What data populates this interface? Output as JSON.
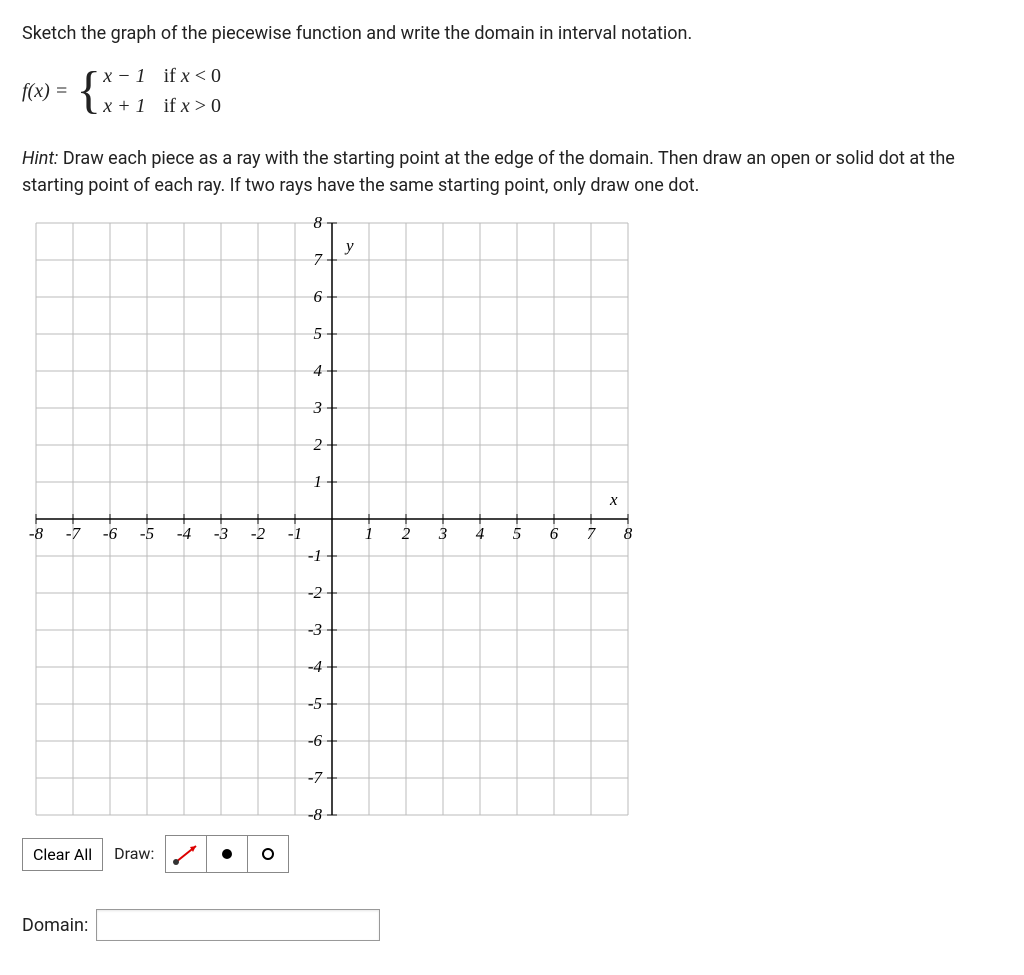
{
  "problem": {
    "instruction": "Sketch the graph of the piecewise function and write the domain in interval notation.",
    "func_lhs": "f(x) = ",
    "piece1_expr": "x − 1",
    "piece1_cond_prefix": "if ",
    "piece1_cond_rel": " < 0",
    "piece2_expr": "x + 1",
    "piece2_cond_prefix": "if ",
    "piece2_cond_rel": " > 0",
    "var": "x"
  },
  "hint": {
    "label": "Hint:",
    "text": " Draw each piece as a ray with the starting point at the edge of the domain. Then draw an open or solid dot at the starting point of each ray. If two rays have the same starting point, only draw one dot."
  },
  "axes": {
    "x_label": "x",
    "y_label": "y",
    "ticks": [
      "-8",
      "-7",
      "-6",
      "-5",
      "-4",
      "-3",
      "-2",
      "-1",
      "1",
      "2",
      "3",
      "4",
      "5",
      "6",
      "7",
      "8"
    ]
  },
  "toolbar": {
    "clear_label": "Clear All",
    "draw_label": "Draw:"
  },
  "domain": {
    "label": "Domain:",
    "value": ""
  },
  "chart_data": {
    "type": "line",
    "title": "",
    "xlabel": "x",
    "ylabel": "y",
    "xlim": [
      -8,
      8
    ],
    "ylim": [
      -8,
      8
    ],
    "grid": true,
    "series": []
  }
}
